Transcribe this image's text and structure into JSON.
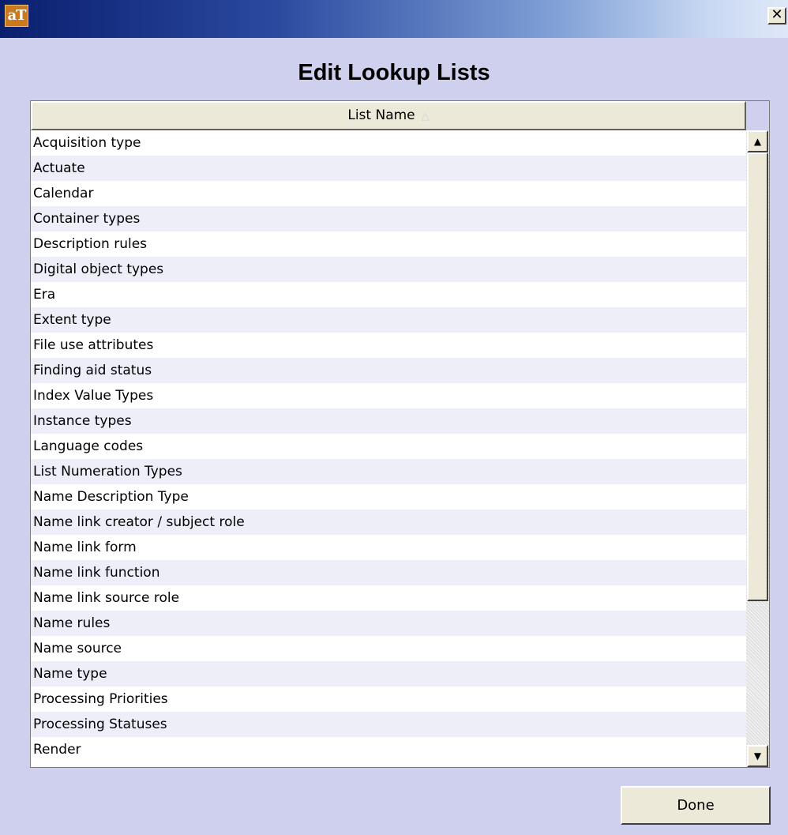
{
  "window": {
    "app_icon_text": "aT",
    "close_label": "✕"
  },
  "dialog": {
    "title": "Edit Lookup Lists"
  },
  "table": {
    "column_header": "List Name",
    "sort_indicator": "△",
    "rows": [
      "Acquisition type",
      "Actuate",
      "Calendar",
      "Container types",
      "Description rules",
      "Digital object types",
      "Era",
      "Extent type",
      "File use attributes",
      "Finding aid status",
      "Index Value Types",
      "Instance types",
      "Language codes",
      "List Numeration Types",
      "Name Description Type",
      "Name link creator / subject role",
      "Name link form",
      "Name link function",
      "Name link source role",
      "Name rules",
      "Name source",
      "Name type",
      "Processing Priorities",
      "Processing Statuses",
      "Render"
    ]
  },
  "scrollbar": {
    "up_icon": "▲",
    "down_icon": "▼"
  },
  "buttons": {
    "done_label": "Done"
  }
}
